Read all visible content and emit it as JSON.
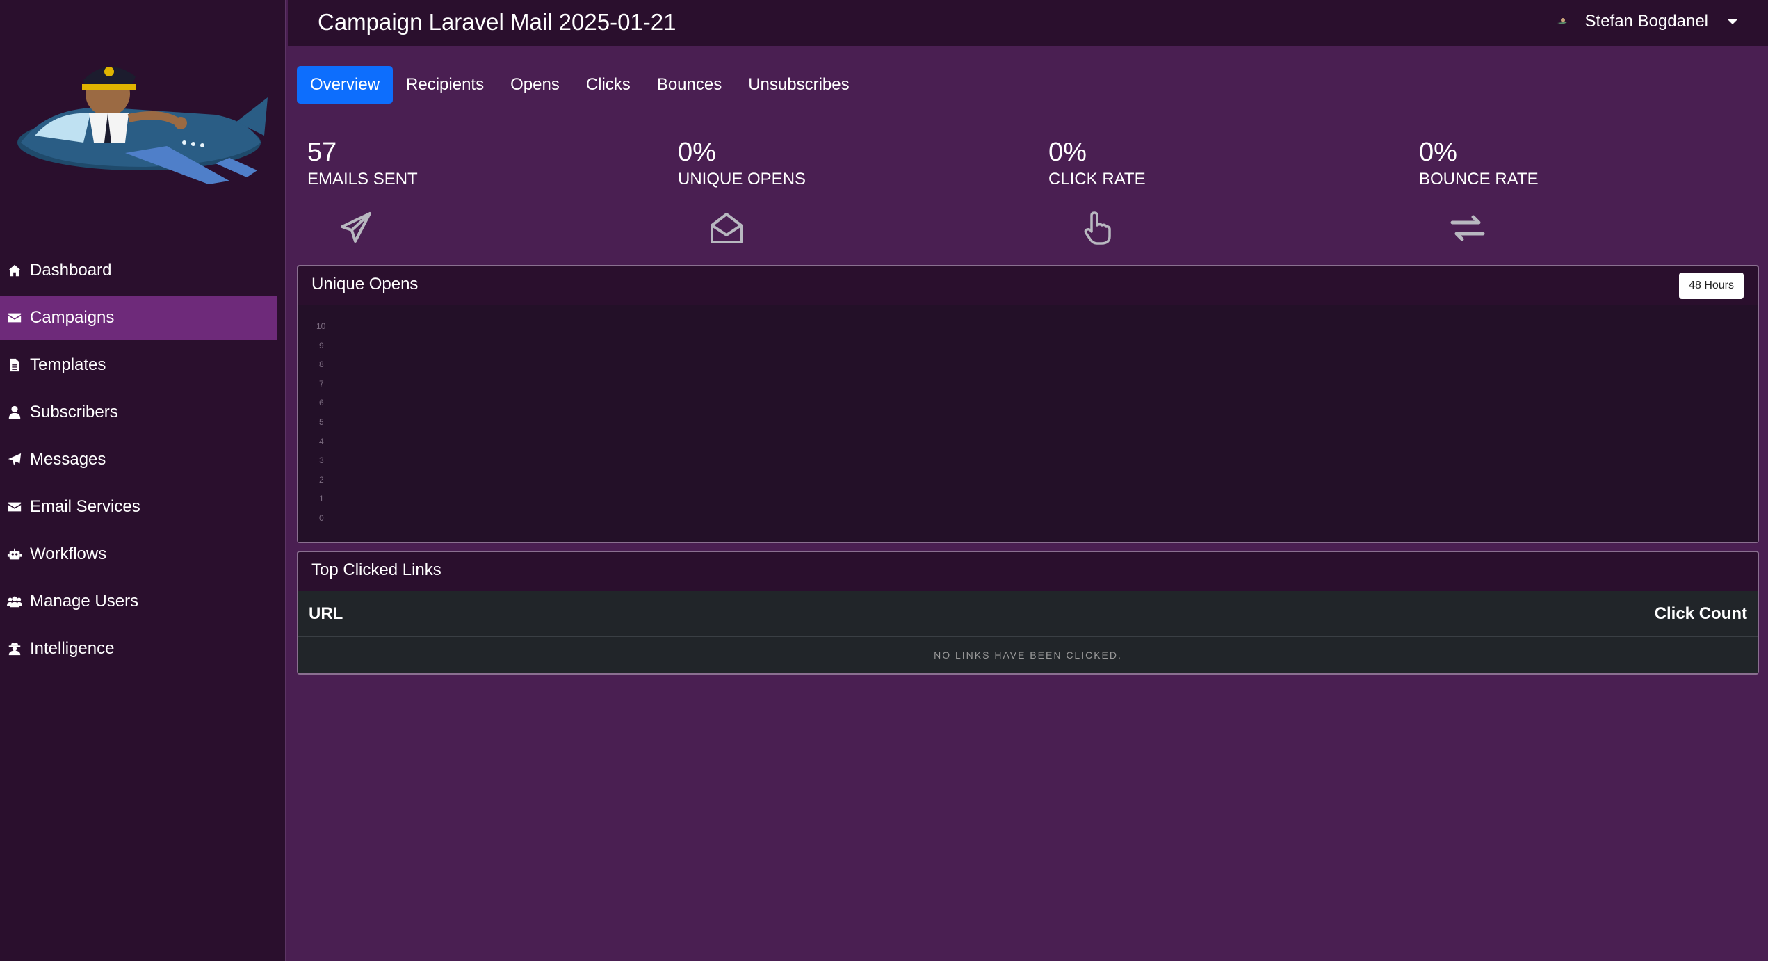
{
  "header": {
    "title": "Campaign Laravel Mail 2025-01-21",
    "user_name": "Stefan Bogdanel"
  },
  "sidebar": {
    "items": [
      {
        "label": "Dashboard",
        "icon": "home-icon"
      },
      {
        "label": "Campaigns",
        "icon": "envelope-icon",
        "active": true
      },
      {
        "label": "Templates",
        "icon": "file-icon"
      },
      {
        "label": "Subscribers",
        "icon": "user-icon"
      },
      {
        "label": "Messages",
        "icon": "paper-plane-icon"
      },
      {
        "label": "Email Services",
        "icon": "envelope-icon"
      },
      {
        "label": "Workflows",
        "icon": "robot-icon"
      },
      {
        "label": "Manage Users",
        "icon": "users-icon"
      },
      {
        "label": "Intelligence",
        "icon": "user-secret-icon"
      }
    ]
  },
  "tabs": [
    {
      "label": "Overview",
      "active": true
    },
    {
      "label": "Recipients"
    },
    {
      "label": "Opens"
    },
    {
      "label": "Clicks"
    },
    {
      "label": "Bounces"
    },
    {
      "label": "Unsubscribes"
    }
  ],
  "stats": [
    {
      "value": "57",
      "label": "EMAILS SENT",
      "icon": "paper-plane-icon"
    },
    {
      "value": "0%",
      "label": "UNIQUE OPENS",
      "icon": "envelope-open-icon"
    },
    {
      "value": "0%",
      "label": "CLICK RATE",
      "icon": "hand-pointer-icon"
    },
    {
      "value": "0%",
      "label": "BOUNCE RATE",
      "icon": "exchange-icon"
    }
  ],
  "unique_opens": {
    "title": "Unique Opens",
    "range_button": "48 Hours",
    "y_ticks": [
      "10",
      "9",
      "8",
      "7",
      "6",
      "5",
      "4",
      "3",
      "2",
      "1",
      "0"
    ]
  },
  "top_links": {
    "title": "Top Clicked Links",
    "col_url": "URL",
    "col_count": "Click Count",
    "empty_message": "NO LINKS HAVE BEEN CLICKED."
  },
  "colors": {
    "page_bg": "#4a1f52",
    "sidebar_bg": "#2a0f2d",
    "active_nav": "#6e2a7a",
    "active_tab": "#0d6efd"
  }
}
